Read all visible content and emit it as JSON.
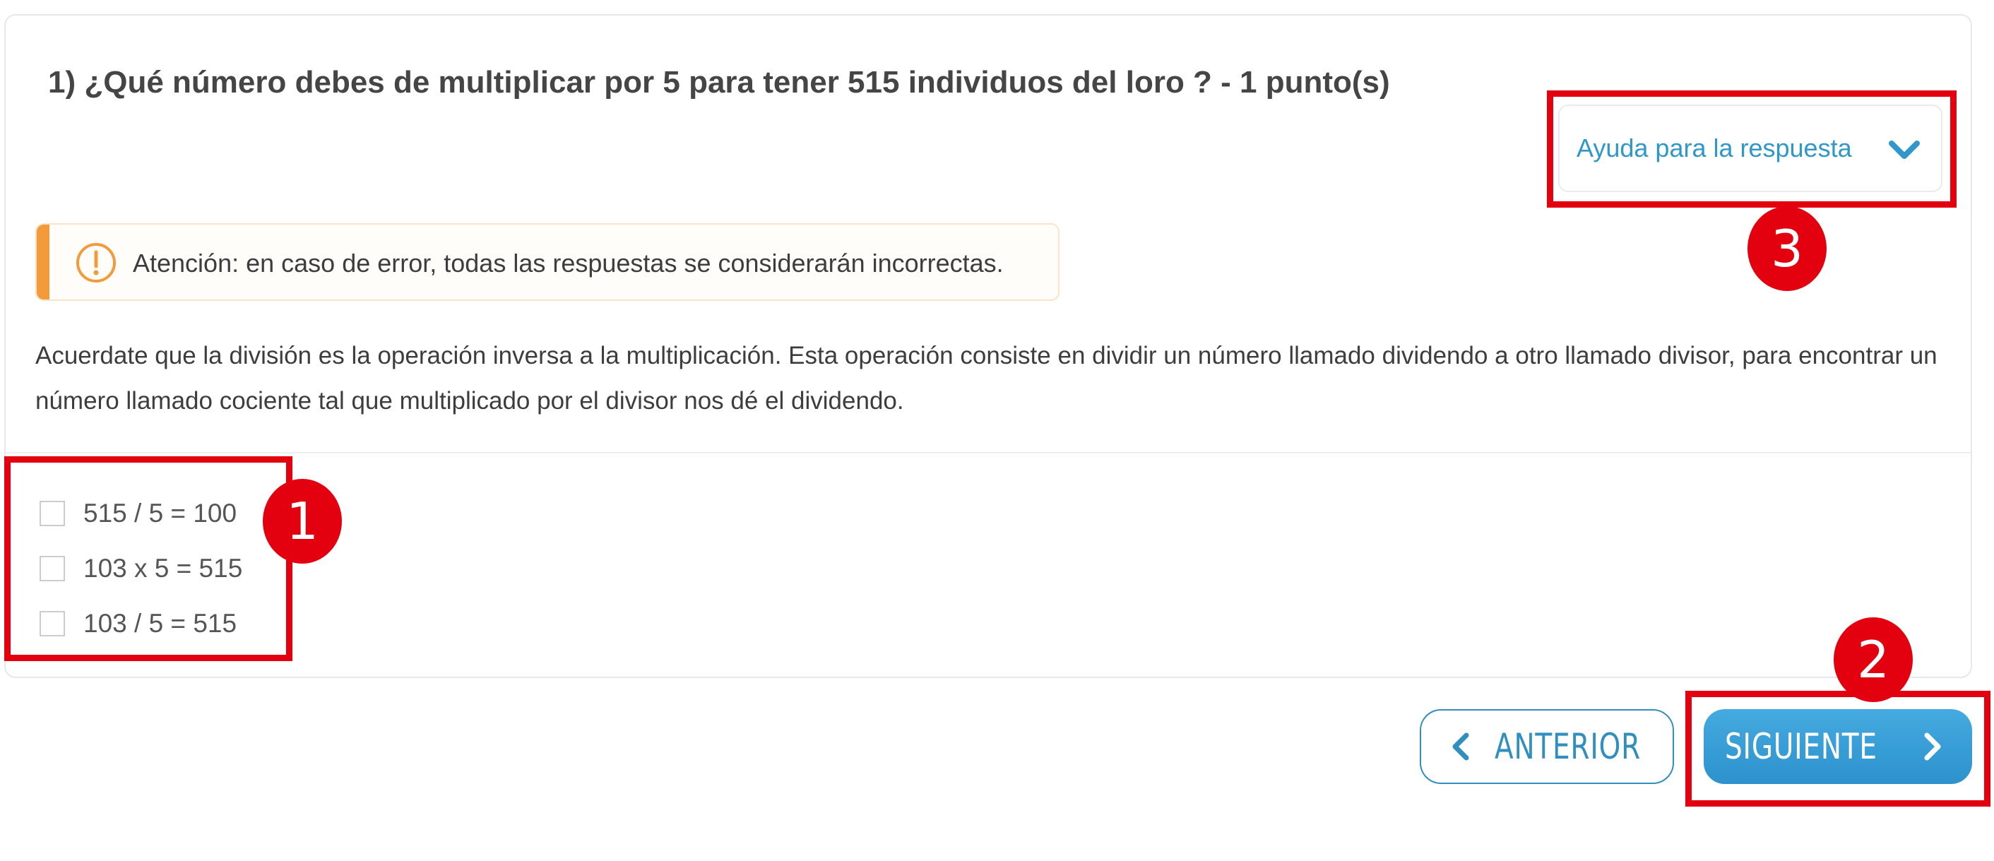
{
  "question": {
    "title": "1) ¿Qué número debes de multiplicar por 5 para tener 515 individuos del loro ? - 1 punto(s)"
  },
  "help": {
    "label": "Ayuda para la respuesta",
    "icon": "chevron-down-icon",
    "color": "#2f97c9"
  },
  "alert": {
    "icon": "exclamation-circle-icon",
    "text": "Atención: en caso de error, todas las respuestas se considerarán incorrectas.",
    "accent_color": "#f39a3a"
  },
  "explanation": {
    "text": "Acuerdate que la división es la operación inversa a la multiplicación. Esta operación consiste en dividir un número llamado dividendo a otro llamado divisor, para encontrar un número llamado cociente tal que multiplicado por el divisor nos dé el dividendo."
  },
  "options": [
    {
      "label": "515 / 5 = 100",
      "checked": false
    },
    {
      "label": "103 x 5 = 515",
      "checked": false
    },
    {
      "label": "103 / 5 = 515",
      "checked": false
    }
  ],
  "navigation": {
    "prev_label": "ANTERIOR",
    "next_label": "SIGUIENTE",
    "primary_color": "#2f92cd"
  },
  "annotations": {
    "color": "#e3000f",
    "labels": [
      "1",
      "2",
      "3"
    ]
  }
}
